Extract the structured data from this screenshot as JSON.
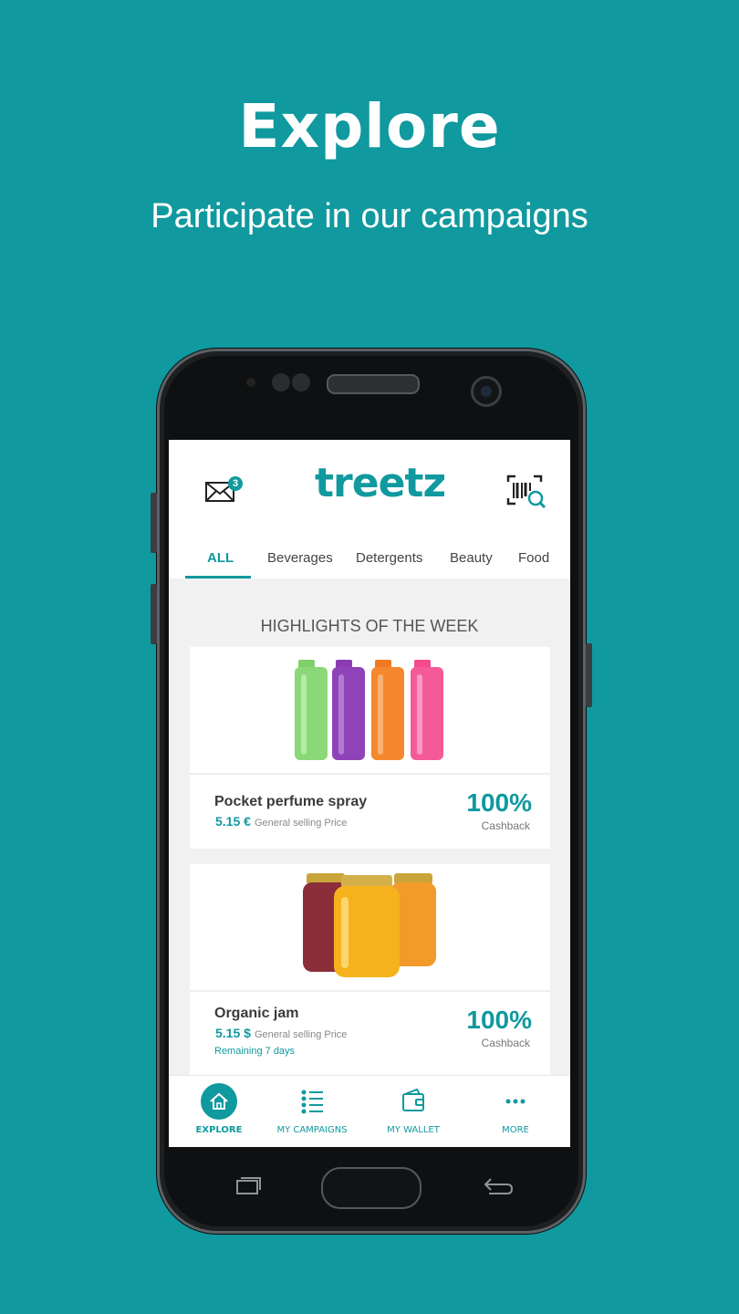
{
  "hero": {
    "title": "Explore",
    "subtitle": "Participate in our campaigns"
  },
  "header": {
    "logo": "treetz",
    "mail_badge": "3",
    "mail_icon": "envelope-icon",
    "scan_icon": "barcode-search-icon"
  },
  "tabs": [
    {
      "label": "ALL",
      "active": true
    },
    {
      "label": "Beverages"
    },
    {
      "label": "Detergents"
    },
    {
      "label": "Beauty"
    },
    {
      "label": "Food"
    }
  ],
  "section_title": "HIGHLIGHTS OF THE WEEK",
  "cards": [
    {
      "name": "Pocket perfume spray",
      "price": "5.15 €",
      "price_label": "General selling Price",
      "cashback_pct": "100%",
      "cashback_label": "Cashback",
      "image": "shampoo-bottles"
    },
    {
      "name": "Organic jam",
      "price": "5.15 $",
      "price_label": "General selling Price",
      "remaining": "Remaining 7 days",
      "cashback_pct": "100%",
      "cashback_label": "Cashback",
      "image": "jam-jars"
    }
  ],
  "bottom_nav": [
    {
      "label": "EXPLORE",
      "icon": "home-icon",
      "active": true
    },
    {
      "label": "MY CAMPAIGNS",
      "icon": "list-icon"
    },
    {
      "label": "MY WALLET",
      "icon": "wallet-icon"
    },
    {
      "label": "MORE",
      "icon": "more-icon"
    }
  ],
  "colors": {
    "accent": "#10999f",
    "background": "#10999f",
    "phone": "#1d1f21"
  }
}
